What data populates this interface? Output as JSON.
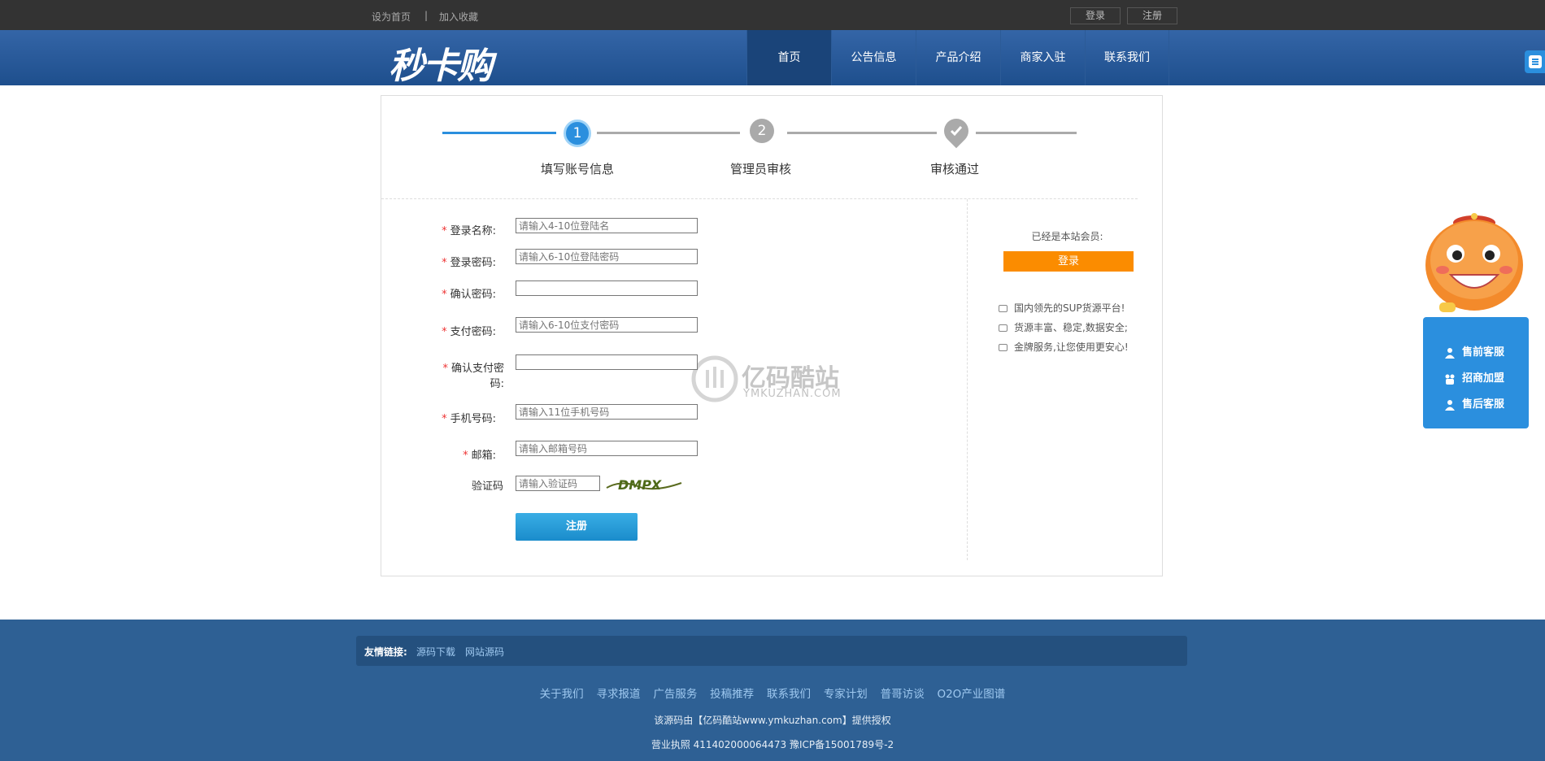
{
  "topbar": {
    "set_home": "设为首页",
    "sep": "|",
    "favorite": "加入收藏",
    "login": "登录",
    "register": "注册"
  },
  "header": {
    "logo": "秒卡购",
    "nav": [
      "首页",
      "公告信息",
      "产品介绍",
      "商家入驻",
      "联系我们"
    ],
    "active_index": 0
  },
  "steps": [
    {
      "num": "1",
      "label": "填写账号信息"
    },
    {
      "num": "2",
      "label": "管理员审核"
    },
    {
      "num": "",
      "label": "审核通过"
    }
  ],
  "form": {
    "login_name": {
      "label": "登录名称:",
      "placeholder": "请输入4-10位登陆名"
    },
    "login_pwd": {
      "label": "登录密码:",
      "placeholder": "请输入6-10位登陆密码"
    },
    "confirm_pwd": {
      "label": "确认密码:",
      "placeholder": ""
    },
    "pay_pwd": {
      "label": "支付密码:",
      "placeholder": "请输入6-10位支付密码"
    },
    "confirm_pay_pwd": {
      "label": "确认支付密",
      "label2": "码:",
      "placeholder": ""
    },
    "phone": {
      "label": "手机号码:",
      "placeholder": "请输入11位手机号码"
    },
    "email": {
      "label": "邮箱:",
      "placeholder": "请输入邮箱号码"
    },
    "captcha": {
      "label": "验证码",
      "placeholder": "请输入验证码",
      "image_text": "DMPX"
    },
    "required_mark": "*",
    "submit": "注册"
  },
  "sidebar_member": {
    "text": "已经是本站会员:",
    "login": "登录",
    "features": [
      "国内领先的SUP货源平台!",
      "货源丰富、稳定,数据安全;",
      "金牌服务,让您使用更安心!"
    ]
  },
  "watermark": {
    "text": "亿码酷站",
    "sub": "YMKUZHAN.COM"
  },
  "service": {
    "items": [
      "售前客服",
      "招商加盟",
      "售后客服"
    ]
  },
  "footer": {
    "friend_label": "友情链接:",
    "friend_links": [
      "源码下载",
      "网站源码"
    ],
    "links": [
      "关于我们",
      "寻求报道",
      "广告服务",
      "投稿推荐",
      "联系我们",
      "专家计划",
      "普哥访谈",
      "O2O产业图谱"
    ],
    "copyright": "该源码由【亿码酷站www.ymkuzhan.com】提供授权",
    "license": "营业执照 411402000064473 豫ICP备15001789号-2"
  },
  "colors": {
    "header": "#2e5f9c",
    "accent": "#2b8fde",
    "orange": "#fb8c00",
    "footer": "#2e6094"
  }
}
